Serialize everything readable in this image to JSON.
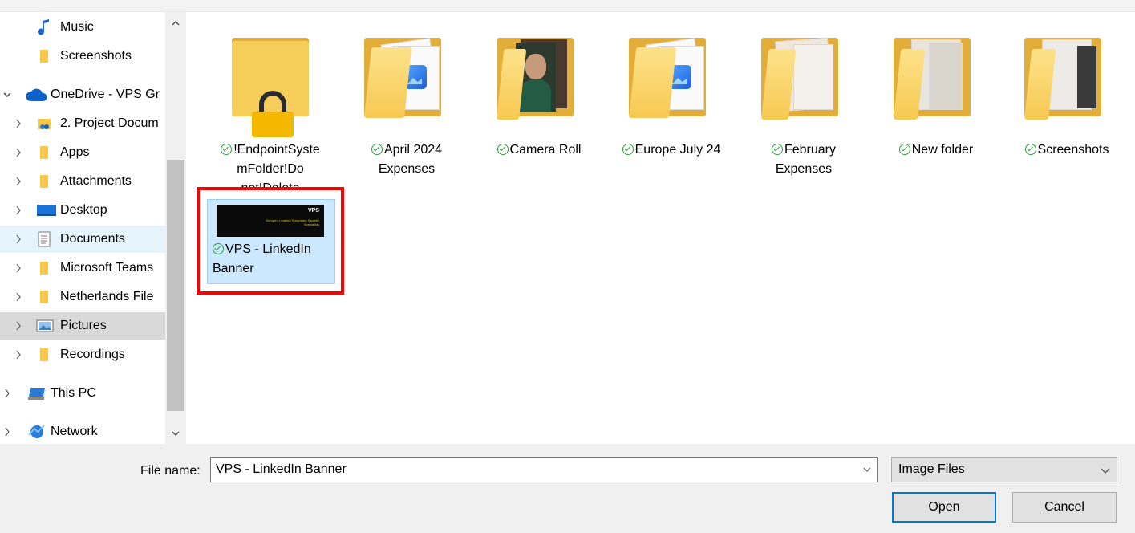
{
  "navigation": {
    "items": [
      {
        "label": "Music",
        "icon": "music-note-icon",
        "indent": 1
      },
      {
        "label": "Screenshots",
        "icon": "folder-icon",
        "indent": 1
      },
      {
        "label": "OneDrive - VPS Gr",
        "icon": "onedrive-cloud-icon",
        "indent": 0
      },
      {
        "label": "2. Project Docum",
        "icon": "sharepoint-folder-icon",
        "indent": 1
      },
      {
        "label": "Apps",
        "icon": "folder-icon",
        "indent": 1
      },
      {
        "label": "Attachments",
        "icon": "folder-icon",
        "indent": 1
      },
      {
        "label": "Desktop",
        "icon": "desktop-icon",
        "indent": 1
      },
      {
        "label": "Documents",
        "icon": "documents-icon",
        "indent": 1
      },
      {
        "label": "Microsoft Teams",
        "icon": "folder-icon",
        "indent": 1
      },
      {
        "label": "Netherlands File",
        "icon": "folder-icon",
        "indent": 1
      },
      {
        "label": "Pictures",
        "icon": "pictures-icon",
        "indent": 1
      },
      {
        "label": "Recordings",
        "icon": "folder-icon",
        "indent": 1
      },
      {
        "label": "This PC",
        "icon": "this-pc-icon",
        "indent": 0
      },
      {
        "label": "Network",
        "icon": "network-icon",
        "indent": 0
      }
    ],
    "hovered": "Documents",
    "selected": "Pictures"
  },
  "content": {
    "folders": [
      {
        "name": "!EndpointSystemFolder!Do not!Delete",
        "lines": [
          "!EndpointSyste",
          "mFolder!Do",
          "not!Delete"
        ],
        "locked": true
      },
      {
        "name": "April 2024 Expenses",
        "lines": [
          "April 2024",
          "Expenses"
        ]
      },
      {
        "name": "Camera Roll",
        "lines": [
          "Camera Roll"
        ]
      },
      {
        "name": "Europe July 24",
        "lines": [
          "Europe July 24"
        ]
      },
      {
        "name": "February Expenses",
        "lines": [
          "February",
          "Expenses"
        ]
      },
      {
        "name": "New folder",
        "lines": [
          "New folder"
        ]
      },
      {
        "name": "Screenshots",
        "lines": [
          "Screenshots"
        ]
      }
    ],
    "selected_file": {
      "lines": [
        "VPS - LinkedIn",
        "Banner"
      ],
      "thumb_logo": "VPS",
      "thumb_tagline": "Europe's Leading Temporary Security Specialists"
    }
  },
  "footer": {
    "file_name_label": "File name:",
    "file_name_value": "VPS - LinkedIn Banner",
    "file_type": "Image Files",
    "open_label": "Open",
    "cancel_label": "Cancel"
  },
  "colors": {
    "selection": "#cce8ff",
    "highlight_box": "#ff0000",
    "sync_ok": "#2e9e3f",
    "default_button_border": "#0078d7"
  }
}
